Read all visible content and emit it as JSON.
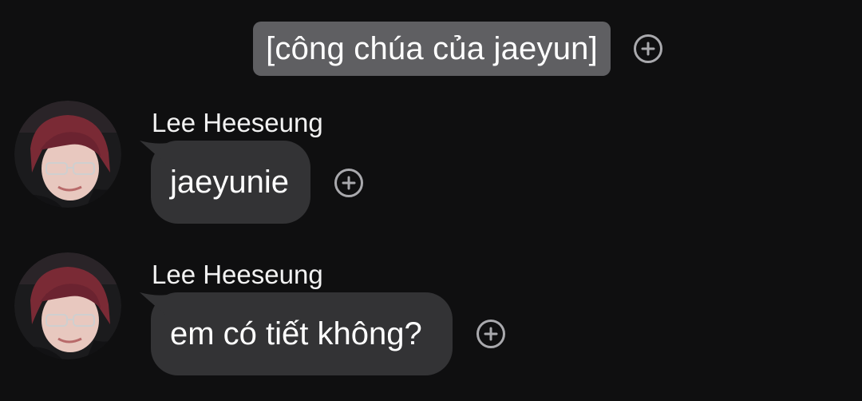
{
  "notice": {
    "text": "[công chúa của jaeyun]"
  },
  "messages": [
    {
      "sender": "Lee Heeseung",
      "text": "jaeyunie"
    },
    {
      "sender": "Lee Heeseung",
      "text": "em có tiết không?"
    }
  ],
  "icons": {
    "react": "add-circle-icon",
    "avatar": "profile-photo"
  },
  "colors": {
    "background": "#0f0f10",
    "bubble": "#333335",
    "notice_pill": "#5f5f62",
    "icon_stroke": "#a9a9ad",
    "avatar_hair": "#7a2a35"
  }
}
